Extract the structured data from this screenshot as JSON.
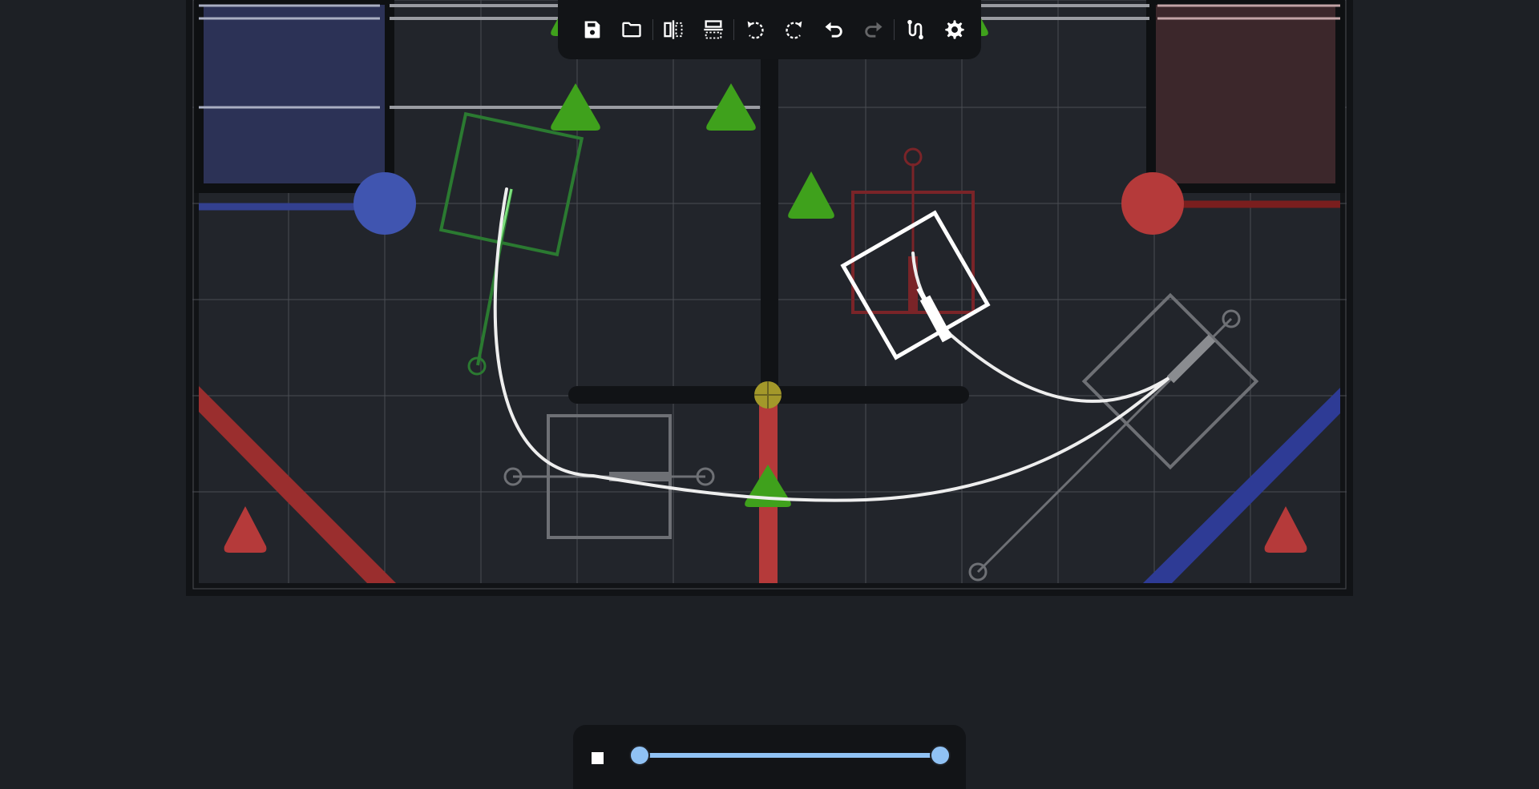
{
  "app": {
    "theme": {
      "background": "#1d2025",
      "panel": "#121417",
      "accent": "#90c2f4",
      "red_alliance": "#b53a3a",
      "blue_alliance": "#3a52b5",
      "game_piece": "#3fa11c",
      "path": "#ffffff"
    }
  },
  "toolbar": {
    "items": [
      {
        "icon": "save-icon",
        "enabled": true
      },
      {
        "icon": "folder-open-icon",
        "enabled": true
      },
      {
        "icon": "mirror-horizontal-icon",
        "enabled": true
      },
      {
        "icon": "mirror-vertical-icon",
        "enabled": true
      },
      {
        "icon": "rotate-left-icon",
        "enabled": true
      },
      {
        "icon": "rotate-right-icon",
        "enabled": true
      },
      {
        "icon": "undo-icon",
        "enabled": true
      },
      {
        "icon": "redo-icon",
        "enabled": false
      },
      {
        "icon": "path-route-icon",
        "enabled": true
      },
      {
        "icon": "settings-gear-icon",
        "enabled": true
      }
    ]
  },
  "playback": {
    "state_icon": "stop-icon",
    "range": [
      0.0,
      1.0
    ]
  }
}
